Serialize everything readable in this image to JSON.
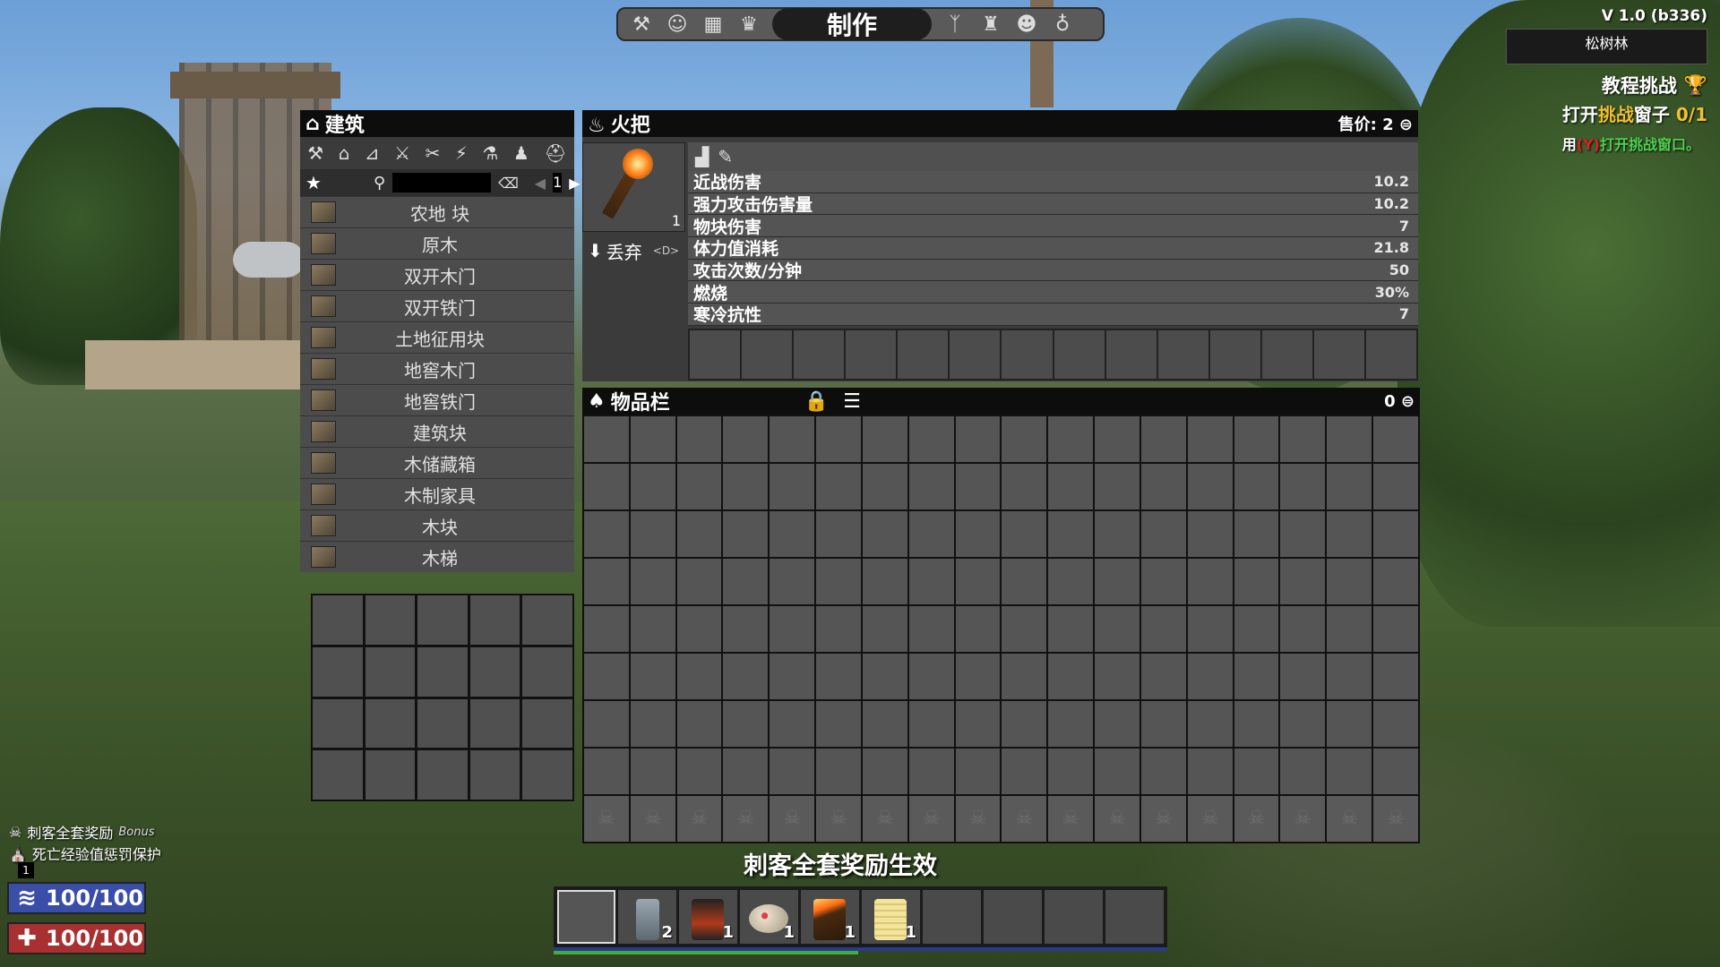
{
  "top_bar": {
    "icons": [
      "hammer-icon",
      "character-icon",
      "map-icon",
      "skills-icon",
      "challenges-icon",
      "trophy-icon",
      "players-icon",
      "lightbulb-icon"
    ],
    "active_tab": "制作"
  },
  "hud": {
    "version": "V 1.0 (b336)",
    "biome": "松树林",
    "challenge": {
      "title": "教程挑战",
      "line_prefix": "打开",
      "line_highlight": "挑战",
      "line_suffix": "窗子",
      "progress": "0/1",
      "hint_prefix": "用",
      "hint_key": "(Y)",
      "hint_text": "打开挑战窗口。"
    }
  },
  "build_panel": {
    "title": "建筑",
    "category_icons": [
      "tools-icon",
      "building-icon",
      "stairs-icon",
      "weapons-icon",
      "traps-icon",
      "electrical-icon",
      "science-icon",
      "clothing-icon",
      "armor-icon"
    ],
    "page": "1",
    "recipes": [
      {
        "name": "农地 块"
      },
      {
        "name": "原木"
      },
      {
        "name": "双开木门"
      },
      {
        "name": "双开铁门"
      },
      {
        "name": "土地征用块"
      },
      {
        "name": "地窖木门"
      },
      {
        "name": "地窖铁门"
      },
      {
        "name": "建筑块"
      },
      {
        "name": "木储藏箱"
      },
      {
        "name": "木制家具"
      },
      {
        "name": "木块"
      },
      {
        "name": "木梯"
      }
    ]
  },
  "item_panel": {
    "title": "火把",
    "sell_label": "售价: 2",
    "count": "1",
    "drop_label": "丢弃",
    "drop_key": "<D>",
    "stats": [
      {
        "label": "近战伤害",
        "value": "10.2"
      },
      {
        "label": "强力攻击伤害量",
        "value": "10.2"
      },
      {
        "label": "物块伤害",
        "value": "7"
      },
      {
        "label": "体力值消耗",
        "value": "21.8"
      },
      {
        "label": "攻击次数/分钟",
        "value": "50"
      },
      {
        "label": "燃烧",
        "value": "30%"
      },
      {
        "label": "寒冷抗性",
        "value": "7"
      }
    ]
  },
  "inventory": {
    "title": "物品栏",
    "currency": "0"
  },
  "buffs": {
    "assassin": "刺客全套奖励",
    "assassin_bonus": "Bonus",
    "death_protect": "死亡经验值惩罚保护",
    "count": "1",
    "message": "刺客全套奖励生效"
  },
  "vitals": {
    "stamina": "100/100",
    "health": "100/100",
    "stamina_color": "#3a4ea8",
    "health_color": "#a83030"
  },
  "toolbelt": {
    "slots": [
      {
        "item": "",
        "count": ""
      },
      {
        "item": "water-bottle",
        "count": "2"
      },
      {
        "item": "canned-food",
        "count": "1"
      },
      {
        "item": "first-aid-cap",
        "count": "1"
      },
      {
        "item": "torch",
        "count": "1"
      },
      {
        "item": "note",
        "count": "1"
      },
      {
        "item": "",
        "count": ""
      },
      {
        "item": "",
        "count": ""
      },
      {
        "item": "",
        "count": ""
      },
      {
        "item": "",
        "count": ""
      }
    ]
  }
}
